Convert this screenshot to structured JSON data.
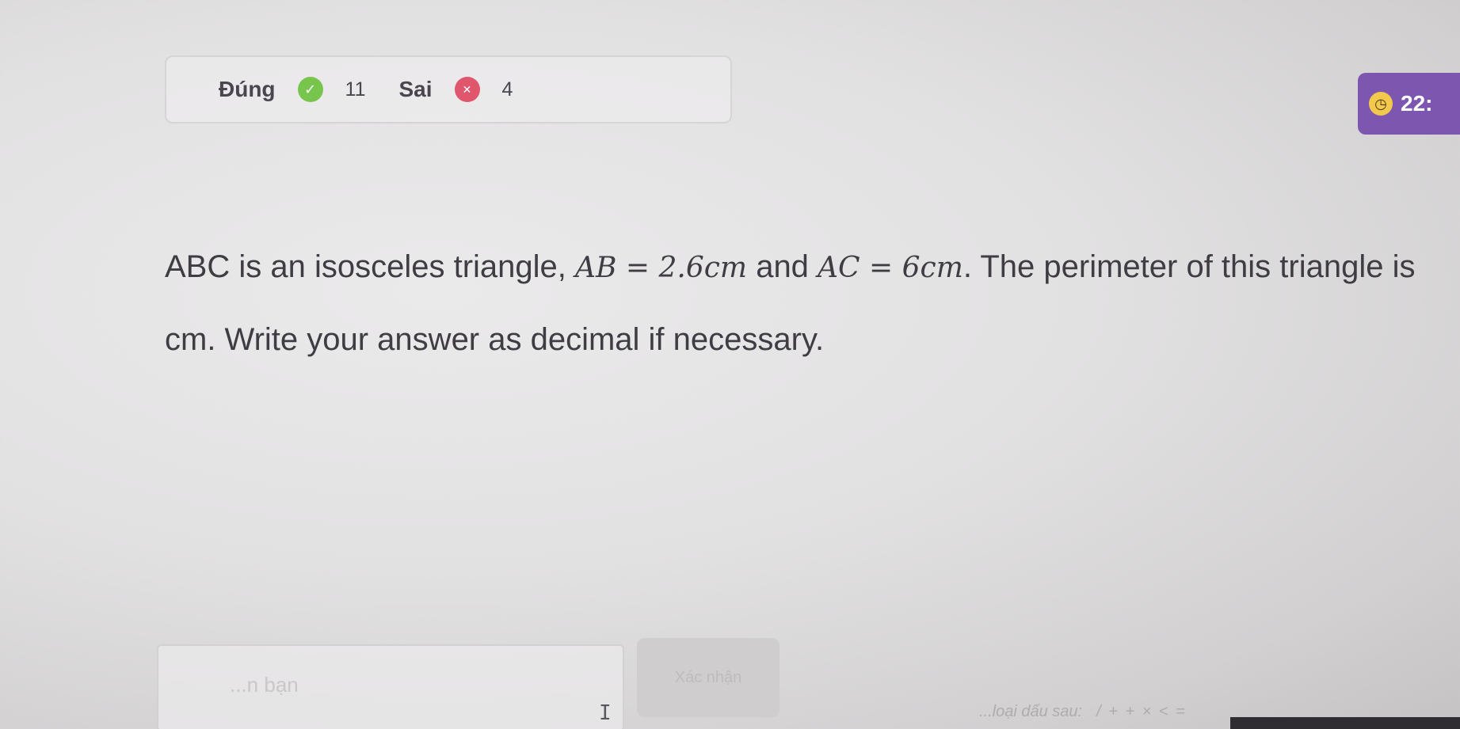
{
  "score": {
    "correct_label": "Đúng",
    "correct_count": "11",
    "wrong_label": "Sai",
    "wrong_count": "4"
  },
  "timer": {
    "value": "22:"
  },
  "question": {
    "line1_intro": "ABC is an isosceles triangle, ",
    "math_ab": "AB = 2.6cm",
    "and": " and ",
    "math_ac": "AC = 6cm",
    "line1_rest": ". The perimeter of this triangle is",
    "line2": "cm. Write your answer as decimal if necessary."
  },
  "answer": {
    "placeholder": "...n bạn"
  },
  "submit": {
    "label": "Xác nhận"
  },
  "hint": {
    "text": "...loại dấu sau:",
    "ops": "/ + + × < ="
  },
  "icons": {
    "correct": "check-circle-icon",
    "wrong": "x-circle-icon",
    "timer": "clock-icon",
    "cursor": "text-cursor-icon"
  },
  "colors": {
    "correct": "#78c54e",
    "wrong": "#e0566c",
    "timer_bg": "#7d56b0"
  }
}
